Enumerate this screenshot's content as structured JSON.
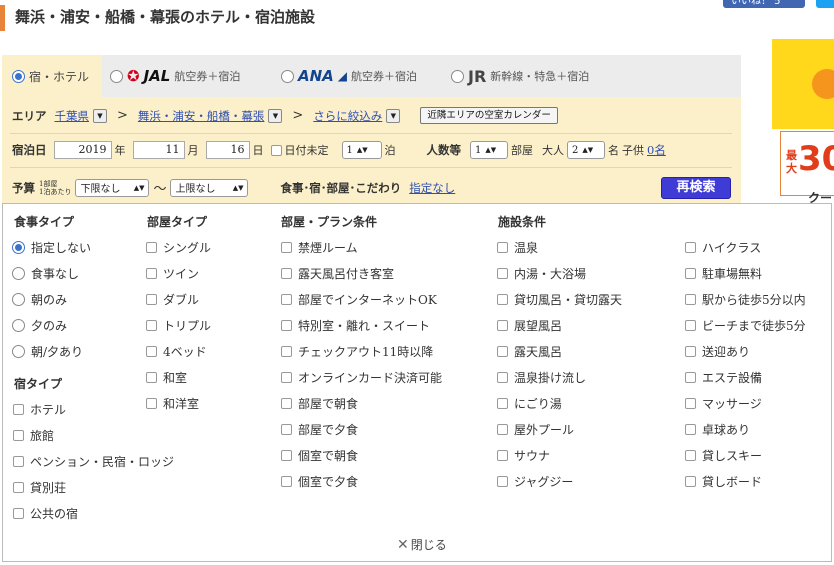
{
  "page": {
    "title": "舞浜・浦安・船橋・幕張のホテル・宿泊施設"
  },
  "share": {
    "like_label": "いいね！ 5"
  },
  "tabs": [
    {
      "label": "宿・ホテル",
      "selected": true
    },
    {
      "logo": "JAL",
      "label": "航空券＋宿泊",
      "selected": false
    },
    {
      "logo": "ANA",
      "label": "航空券＋宿泊",
      "selected": false
    },
    {
      "logo": "JR",
      "label": "新幹線・特急＋宿泊",
      "selected": false
    }
  ],
  "area": {
    "label": "エリア",
    "prefecture": "千葉県",
    "region": "舞浜・浦安・船橋・幕張",
    "refine": "さらに絞込み",
    "separator": ">",
    "calendar_button": "近隣エリアの空室カレンダー"
  },
  "stay": {
    "label": "宿泊日",
    "year": "2019",
    "year_unit": "年",
    "month": "11",
    "month_unit": "月",
    "day": "16",
    "day_unit": "日",
    "undecided_label": "日付未定",
    "nights": "1",
    "nights_unit": "泊",
    "people_label": "人数等",
    "rooms": "1",
    "rooms_unit": "部屋",
    "adults_label": "大人",
    "adults": "2",
    "adults_unit": "名",
    "children_label": "子供",
    "children": "0名"
  },
  "budget": {
    "label": "予算",
    "sub_label_1": "1部屋",
    "sub_label_2": "1泊あたり",
    "min": "下限なし",
    "tilde": "〜",
    "max": "上限なし",
    "conditions_label": "食事･宿･部屋･こだわり",
    "conditions_link": "指定なし",
    "search_button": "再検索"
  },
  "conditions": {
    "meal_type": {
      "heading": "食事タイプ",
      "options": [
        "指定しない",
        "食事なし",
        "朝のみ",
        "夕のみ",
        "朝/夕あり"
      ],
      "selected": "指定しない"
    },
    "lodging_type": {
      "heading": "宿タイプ",
      "options": [
        "ホテル",
        "旅館",
        "ペンション・民宿・ロッジ",
        "貸別荘",
        "公共の宿"
      ]
    },
    "room_type": {
      "heading": "部屋タイプ",
      "options": [
        "シングル",
        "ツイン",
        "ダブル",
        "トリプル",
        "4ベッド",
        "和室",
        "和洋室"
      ]
    },
    "room_plan": {
      "heading": "部屋・プラン条件",
      "options": [
        "禁煙ルーム",
        "露天風呂付き客室",
        "部屋でインターネットOK",
        "特別室・離れ・スイート",
        "チェックアウト11時以降",
        "オンラインカード決済可能",
        "部屋で朝食",
        "部屋で夕食",
        "個室で朝食",
        "個室で夕食"
      ]
    },
    "facility": {
      "heading": "施設条件",
      "options": [
        "温泉",
        "内湯・大浴場",
        "貸切風呂・貸切露天",
        "展望風呂",
        "露天風呂",
        "温泉掛け流し",
        "にごり湯",
        "屋外プール",
        "サウナ",
        "ジャグジー"
      ],
      "options_2": [
        "ハイクラス",
        "駐車場無料",
        "駅から徒歩5分以内",
        "ビーチまで徒歩5分",
        "送迎あり",
        "エステ設備",
        "マッサージ",
        "卓球あり",
        "貸しスキー",
        "貸しボード"
      ]
    },
    "close_label": "閉じる"
  },
  "ad": {
    "big_text": "30",
    "side_text": "最大",
    "coupon_text": "クー"
  },
  "colors": {
    "accent": "#e8833a",
    "panel_bg": "#fbf0c9",
    "link": "#2f4fb5",
    "button_bg": "#3f3bd6",
    "radio_on": "#3a73c9"
  }
}
